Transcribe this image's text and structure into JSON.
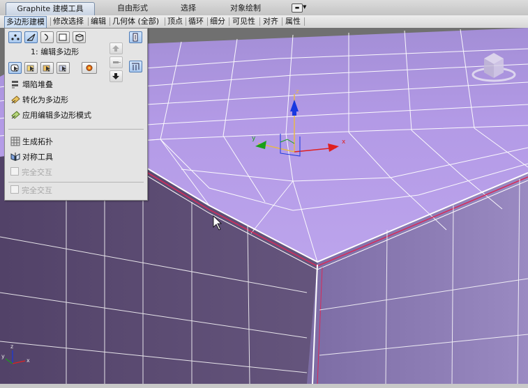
{
  "ribbon": {
    "tabs": [
      {
        "label": "Graphite 建模工具",
        "active": true
      },
      {
        "label": "自由形式",
        "active": false
      },
      {
        "label": "选择",
        "active": false
      },
      {
        "label": "对象绘制",
        "active": false
      }
    ],
    "panels": [
      {
        "label": "多边形建模",
        "active": true
      },
      {
        "label": "修改选择",
        "active": false
      },
      {
        "label": "编辑",
        "active": false
      },
      {
        "label": "几何体 (全部)",
        "active": false
      },
      {
        "label": "顶点",
        "active": false
      },
      {
        "label": "循环",
        "active": false
      },
      {
        "label": "细分",
        "active": false
      },
      {
        "label": "可见性",
        "active": false
      },
      {
        "label": "对齐",
        "active": false
      },
      {
        "label": "属性",
        "active": false
      }
    ]
  },
  "panel": {
    "modifier_label": "1: 编辑多边形",
    "subobject_icons": [
      "vertex-icon",
      "edge-icon",
      "border-icon",
      "polygon-icon",
      "element-icon"
    ],
    "menu": [
      {
        "label": "塌陷堆叠",
        "icon": "collapse-stack-icon",
        "enabled": true
      },
      {
        "label": "转化为多边形",
        "icon": "convert-to-poly-icon",
        "enabled": true
      },
      {
        "label": "应用编辑多边形模式",
        "icon": "apply-edit-poly-icon",
        "enabled": true
      },
      {
        "label": "生成拓扑",
        "icon": "generate-topology-icon",
        "enabled": true
      },
      {
        "label": "对称工具",
        "icon": "symmetry-tool-icon",
        "enabled": true
      },
      {
        "label": "完全交互",
        "icon": "checkbox",
        "enabled": false
      },
      {
        "label": "完全交互",
        "icon": "checkbox",
        "enabled": false
      }
    ]
  },
  "viewport": {
    "gizmo_labels": {
      "x": "x",
      "y": "y",
      "z": "z"
    },
    "corner_axes": {
      "x": "x",
      "y": "y",
      "z": "z"
    },
    "colors": {
      "top": "#b498e6",
      "side": "#5e4e74",
      "background": "#6e6e6e",
      "wire": "#ffffff",
      "x_axis": "#e02020",
      "y_axis": "#18a018",
      "z_axis": "#1838e0",
      "gizmo_center": "#e8b84a"
    }
  }
}
